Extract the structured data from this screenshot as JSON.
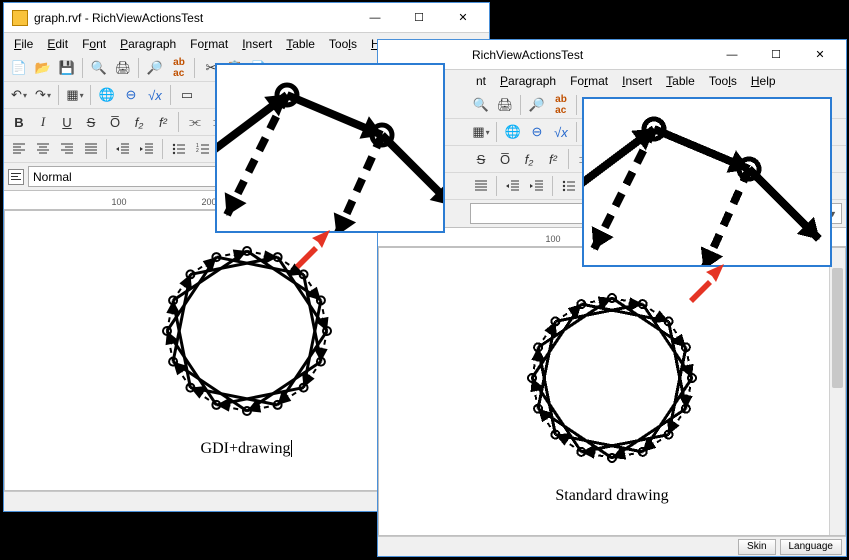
{
  "windows": [
    {
      "title": "graph.rvf - RichViewActionsTest",
      "caption": "GDI+drawing",
      "ruler": {
        "marks": [
          100,
          200
        ]
      },
      "smooth": true
    },
    {
      "title": "RichViewActionsTest",
      "caption": "Standard drawing",
      "ruler": {
        "marks": [
          100
        ]
      },
      "smooth": false
    }
  ],
  "menu": {
    "items": [
      "File",
      "Edit",
      "Font",
      "Paragraph",
      "Format",
      "Insert",
      "Table",
      "Tools",
      "Help"
    ],
    "items_truncated": [
      "nt",
      "Paragraph",
      "Format",
      "Insert",
      "Table",
      "Tools",
      "Help"
    ]
  },
  "style": {
    "normal": "Normal"
  },
  "status": {
    "skin": "Skin",
    "language": "Language"
  },
  "winbuttons": {
    "min": "—",
    "max": "☐",
    "close": "✕"
  },
  "format_labels": {
    "b": "B",
    "i": "I",
    "u": "U",
    "s": "S",
    "o": "O̅",
    "f2": "f₂",
    "fsup2": "f²"
  }
}
